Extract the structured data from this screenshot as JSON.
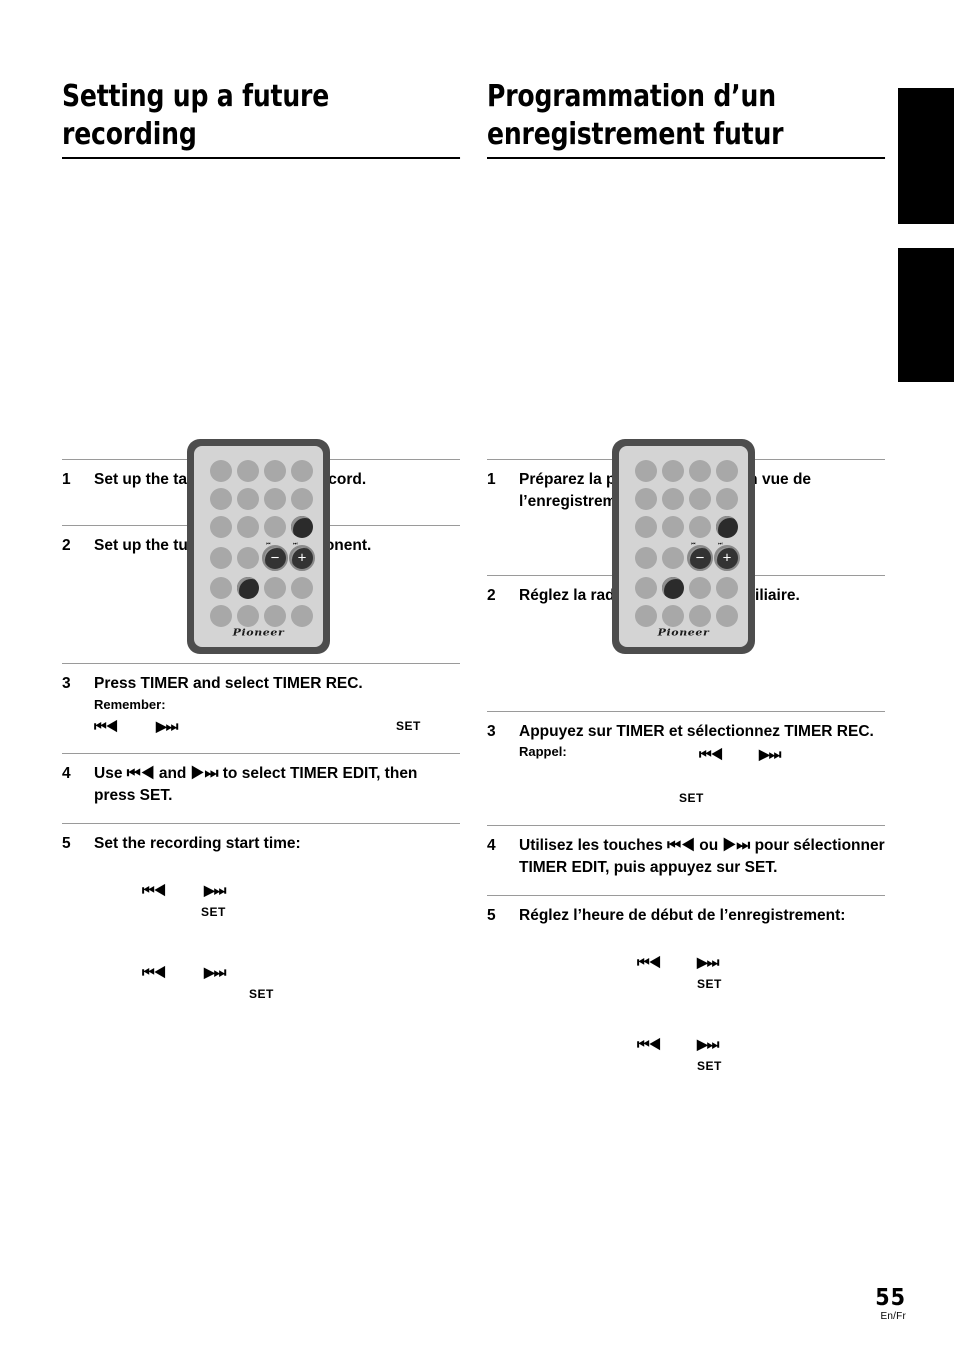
{
  "page": {
    "number": "55",
    "language_code": "En/Fr"
  },
  "tabs": [
    {
      "name": "thumb-tab-upper",
      "color": "#000000"
    },
    {
      "name": "thumb-tab-lower",
      "color": "#000000"
    }
  ],
  "columns": {
    "english": {
      "heading": "Setting up a future recording",
      "remote": {
        "brand": "Pioneer",
        "prev_label": "⏮",
        "next_label": "⏭",
        "minus_label": "−",
        "plus_label": "+"
      },
      "steps": [
        {
          "num": "1",
          "text": "Set up the tape deck ready to record.",
          "sub": "",
          "glyphs": []
        },
        {
          "num": "2",
          "text": "Set up the tuner/auxiliary component.",
          "sub": "",
          "glyphs": []
        },
        {
          "num": "3",
          "text": "Press TIMER and select TIMER REC.",
          "sub": "Remember:",
          "glyph_prev": "⏮◀",
          "glyph_next": "▶⏭",
          "set": "SET"
        },
        {
          "num": "4",
          "text": "Use ⏮◀ and ▶⏭ to select TIMER EDIT, then press SET.",
          "sub": "",
          "glyphs": []
        },
        {
          "num": "5",
          "text": "Set the recording start time:",
          "sub": "",
          "glyph_prev": "⏮◀",
          "glyph_next": "▶⏭",
          "set": "SET"
        }
      ]
    },
    "french": {
      "heading": "Programmation d’un enregistrement futur",
      "remote": {
        "brand": "Pioneer",
        "prev_label": "⏮",
        "next_label": "⏭",
        "minus_label": "−",
        "plus_label": "+"
      },
      "steps": [
        {
          "num": "1",
          "text": "Préparez la platine à cassette en vue de l’enregistrement.",
          "sub": "",
          "glyphs": []
        },
        {
          "num": "2",
          "text": "Réglez la radio ou l’appareil auxiliaire.",
          "sub": "",
          "glyphs": []
        },
        {
          "num": "3",
          "text": "Appuyez sur TIMER et sélectionnez TIMER REC.",
          "sub": "Rappel:",
          "glyph_prev": "⏮◀",
          "glyph_next": "▶⏭",
          "set": "SET"
        },
        {
          "num": "4",
          "text": "Utilisez les touches ⏮◀ ou ▶⏭ pour sélectionner TIMER EDIT, puis appuyez sur SET.",
          "sub": "",
          "glyphs": []
        },
        {
          "num": "5",
          "text": "Réglez l’heure de début de l’enregistrement:",
          "sub": "",
          "glyph_prev": "⏮◀",
          "glyph_next": "▶⏭",
          "set": "SET"
        }
      ]
    }
  }
}
